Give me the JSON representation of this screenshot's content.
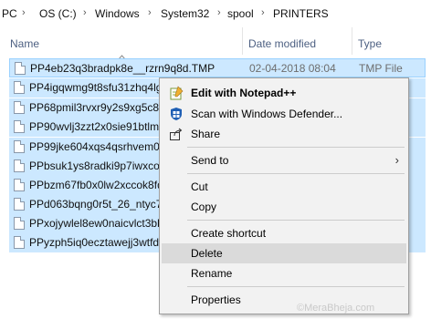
{
  "breadcrumb": {
    "items": [
      "PC",
      "OS (C:)",
      "Windows",
      "System32",
      "spool",
      "PRINTERS"
    ],
    "separator": "›"
  },
  "columns": {
    "name": "Name",
    "date_modified": "Date modified",
    "type": "Type"
  },
  "files": [
    {
      "name": "PP4eb23q3bradpk8e__rzrn9q8d.TMP",
      "date": "02-04-2018 08:04",
      "type": "TMP File"
    },
    {
      "name": "PP4igqwmg9t8sfu31zhq4lg",
      "date": "",
      "type": ""
    },
    {
      "name": "PP68pmil3rvxr9y2s9xg5c8t0",
      "date": "",
      "type": ""
    },
    {
      "name": "PP90wvlj3zzt2x0sie91btlm",
      "date": "",
      "type": ""
    },
    {
      "name": "PP99jke604xqs4qsrhvem0w",
      "date": "",
      "type": ""
    },
    {
      "name": "PPbsuk1ys8radki9p7iwxcor",
      "date": "",
      "type": ""
    },
    {
      "name": "PPbzm67fb0x0lw2xccok8fd",
      "date": "",
      "type": ""
    },
    {
      "name": "PPd063bqng0r5t_26_ntyc78",
      "date": "",
      "type": ""
    },
    {
      "name": "PPxojywlel8ew0naicvlct3bb",
      "date": "",
      "type": ""
    },
    {
      "name": "PPyzph5iq0ecztawejj3wtfdv",
      "date": "",
      "type": ""
    }
  ],
  "context_menu": {
    "edit_notepad": "Edit with Notepad++",
    "scan_defender": "Scan with Windows Defender...",
    "share": "Share",
    "send_to": "Send to",
    "cut": "Cut",
    "copy": "Copy",
    "create_shortcut": "Create shortcut",
    "delete": "Delete",
    "rename": "Rename",
    "properties": "Properties",
    "submenu_arrow": "›"
  },
  "icons": {
    "notepad": "notepad-plus-plus-icon",
    "defender": "windows-defender-shield-icon",
    "share": "share-icon",
    "file": "tmp-file-icon",
    "sort": "sort-up-chevron-icon"
  },
  "colors": {
    "selection_bg": "#cce8ff",
    "selection_border": "#99d1ff",
    "menu_bg": "#f2f2f2",
    "menu_hover": "#dadada",
    "header_text": "#4d6082"
  },
  "watermark": "©MeraBheja.com"
}
